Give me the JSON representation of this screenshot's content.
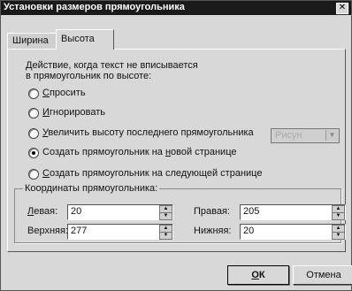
{
  "window": {
    "title": "Установки размеров прямоугольника",
    "close_glyph": "✕"
  },
  "tabs": [
    {
      "label": "Ширина",
      "active": false
    },
    {
      "label": "Высота",
      "active": true
    }
  ],
  "section": {
    "heading_line1": "Действие, когда текст не вписывается",
    "heading_line2": "в прямоугольник по высоте:"
  },
  "options": [
    {
      "label": "Спросить",
      "accel": "С",
      "rest": "просить",
      "checked": false
    },
    {
      "label": "Игнорировать",
      "accel": "И",
      "rest": "гнорировать",
      "checked": false
    },
    {
      "label": "Увеличить высоту последнего прямоугольника",
      "accel": "У",
      "rest": "величить высоту последнего прямоугольника",
      "checked": false
    },
    {
      "label": "Создать прямоугольник на новой странице",
      "prefix": "Создать прямоугольник на ",
      "accel": "н",
      "rest": "овой странице",
      "checked": true
    },
    {
      "label": "Создать прямоугольник на следующей странице",
      "accel": "С",
      "rest": "оздать прямоугольник на следующей странице",
      "checked": false
    }
  ],
  "disabled_combo": {
    "value": "Рисун",
    "arrow_icon": "▼"
  },
  "coordinates": {
    "group_title": "Координаты прямоугольника:",
    "left": {
      "accel": "Л",
      "rest": "евая:",
      "value": "20"
    },
    "top": {
      "label": "Верхняя:",
      "value": "277"
    },
    "right": {
      "label": "Правая:",
      "value": "205"
    },
    "bottom": {
      "label": "Нижняя:",
      "value": "20"
    }
  },
  "spin_icons": {
    "up": "▲",
    "down": "▼"
  },
  "buttons": {
    "ok_accel": "О",
    "ok_rest": "К",
    "cancel": "Отмена"
  },
  "colors": {
    "titlebar": "#1a1a1a",
    "dialog": "#d8d8d8"
  }
}
